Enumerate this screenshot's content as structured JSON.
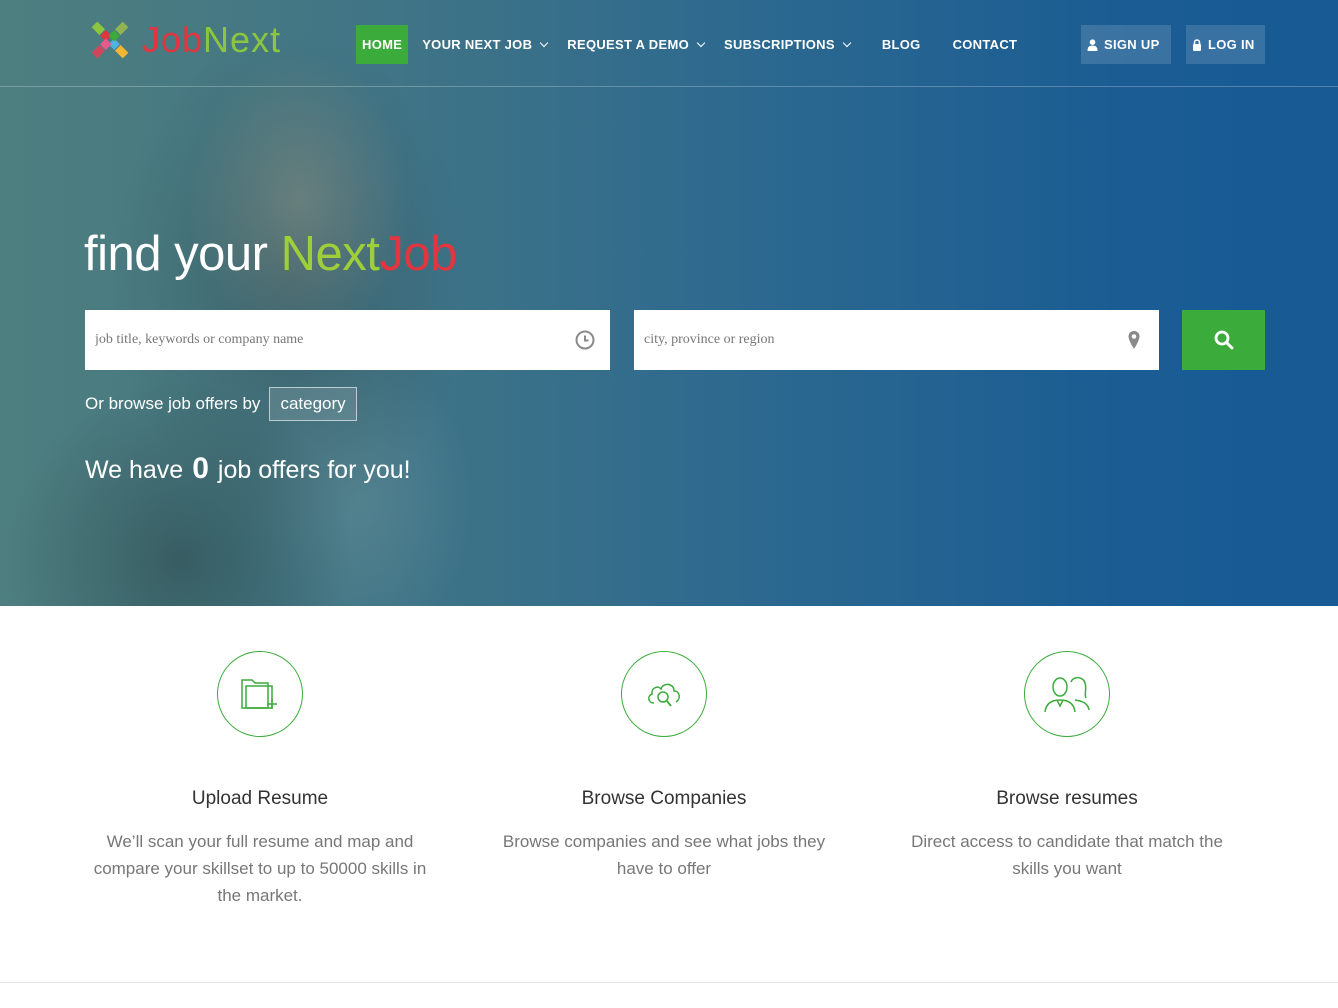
{
  "brand": {
    "name_part1": "Job",
    "name_part2": "Next",
    "logo_icon": "jobnext-logo-icon",
    "colors": {
      "red": "#e2353f",
      "green": "#8cc63f"
    }
  },
  "nav": {
    "items": [
      {
        "label": "HOME",
        "active": true,
        "dropdown": false
      },
      {
        "label": "YOUR NEXT JOB",
        "active": false,
        "dropdown": true
      },
      {
        "label": "REQUEST A DEMO",
        "active": false,
        "dropdown": true
      },
      {
        "label": "SUBSCRIPTIONS",
        "active": false,
        "dropdown": true
      },
      {
        "label": "BLOG",
        "active": false,
        "dropdown": false
      },
      {
        "label": "CONTACT",
        "active": false,
        "dropdown": false
      }
    ],
    "signup_label": "SIGN UP",
    "login_label": "LOG IN",
    "accent_color": "#3bab3b"
  },
  "hero": {
    "headline_part1": "find your",
    "headline_part2": "Next",
    "headline_part3": "Job",
    "search": {
      "keywords_placeholder": "job title, keywords or company name",
      "keywords_icon": "clock-icon",
      "location_placeholder": "city, province or region",
      "location_icon": "map-pin-icon",
      "button_icon": "search-icon"
    },
    "browse_text": "Or browse job offers by",
    "category_label": "category",
    "offers_prefix": "We have",
    "offers_count": "0",
    "offers_suffix": "job offers for you!"
  },
  "features": [
    {
      "icon": "folder-add-icon",
      "title": "Upload Resume",
      "description": "We’ll scan your full resume and map and compare your skillset to up to 50000 skills in the market."
    },
    {
      "icon": "cloud-search-icon",
      "title": "Browse Companies",
      "description": "Browse companies and see what jobs they have to offer"
    },
    {
      "icon": "people-icon",
      "title": "Browse resumes",
      "description": "Direct access to candidate that match the skills you want"
    }
  ]
}
